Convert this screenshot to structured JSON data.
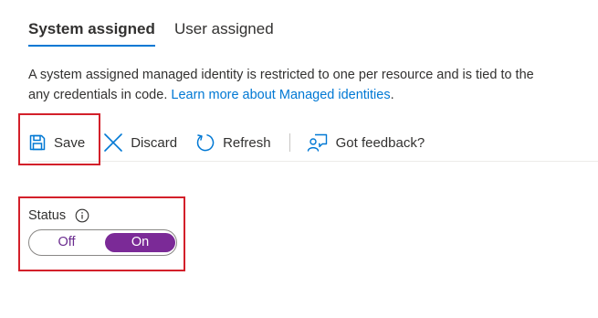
{
  "tabs": [
    {
      "label": "System assigned",
      "selected": true
    },
    {
      "label": "User assigned",
      "selected": false
    }
  ],
  "description": {
    "line1": "A system assigned managed identity is restricted to one per resource and is tied to the",
    "line2_text": "any credentials in code. ",
    "link_text": "Learn more about Managed identities",
    "line2_end": "."
  },
  "toolbar": {
    "save": {
      "label": "Save",
      "icon": "save-icon"
    },
    "discard": {
      "label": "Discard",
      "icon": "close-icon"
    },
    "refresh": {
      "label": "Refresh",
      "icon": "refresh-icon"
    },
    "feedback": {
      "label": "Got feedback?",
      "icon": "feedback-icon"
    }
  },
  "status": {
    "label": "Status",
    "info_icon": "info-icon",
    "options": [
      "Off",
      "On"
    ],
    "selected": "On"
  },
  "colors": {
    "accent": "#0078d4",
    "toggle_on": "#7b2a97",
    "highlight": "#d3202a"
  }
}
